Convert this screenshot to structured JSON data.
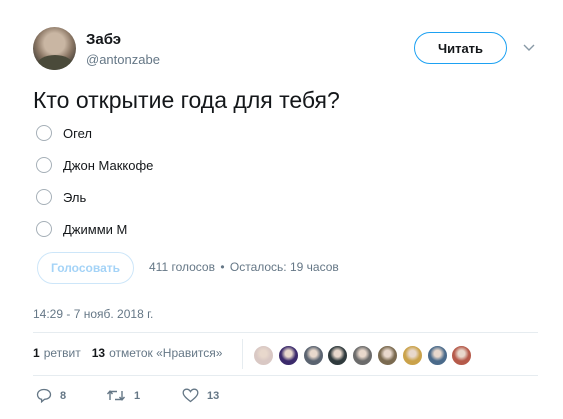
{
  "author": {
    "name": "Забэ",
    "handle": "@antonzabe"
  },
  "follow_button": {
    "label": "Читать"
  },
  "tweet": {
    "question": "Кто открытие года для тебя?"
  },
  "poll": {
    "options": [
      "Огел",
      "Джон Маккофе",
      "Эль",
      "Джимми М"
    ],
    "vote_button_label": "Голосовать",
    "votes": "411 голосов",
    "separator": "•",
    "time_left": "Осталось: 19 часов"
  },
  "timestamp": "14:29 - 7 нояб. 2018 г.",
  "stats": {
    "retweets_count": "1",
    "retweets_label": "ретвит",
    "likes_count": "13",
    "likes_label": "отметок «Нравится»"
  },
  "liker_colors": [
    "#d9c8c4",
    "#3b2a6b",
    "#5a6370",
    "#2f3a3d",
    "#6b6b6b",
    "#7a6a50",
    "#caa24a",
    "#4a6a8a",
    "#b55a4a"
  ],
  "actions": {
    "reply_count": "8",
    "retweet_count": "1",
    "like_count": "13"
  },
  "colors": {
    "accent": "#1da1f2",
    "muted": "#657786",
    "text": "#14171a"
  }
}
